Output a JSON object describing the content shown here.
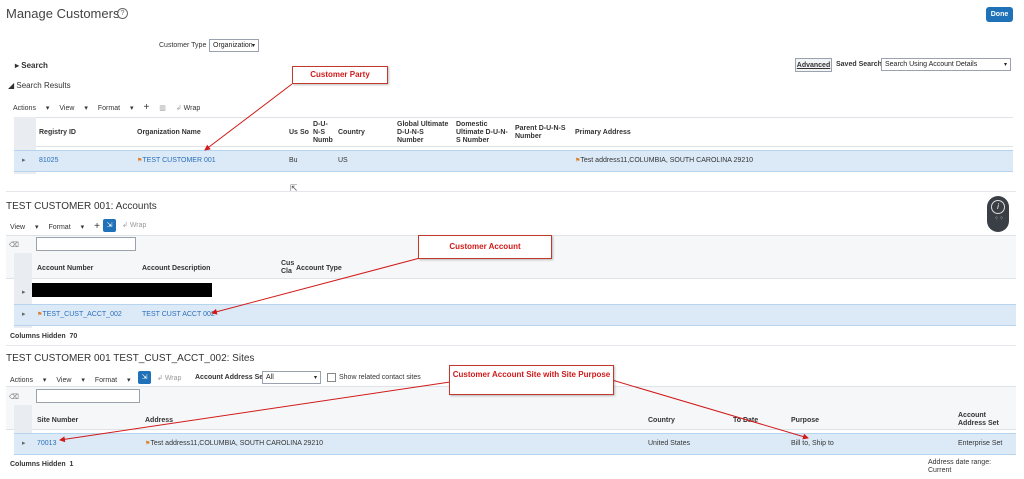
{
  "page": {
    "title": "Manage Customers",
    "done_label": "Done",
    "help_icon": "help-circle-icon"
  },
  "search": {
    "customer_type_label": "Customer Type",
    "customer_type_value": "Organization",
    "search_label": "Search",
    "search_results_label": "Search Results",
    "advanced_label": "Advanced",
    "saved_search_label": "Saved Search",
    "saved_search_value": "Search Using Account Details"
  },
  "results_toolbar": {
    "actions": "Actions",
    "view": "View",
    "format": "Format",
    "wrap": "Wrap"
  },
  "results_table": {
    "headers": {
      "registry_id": "Registry ID",
      "org_name": "Organization Name",
      "us": "Us",
      "so": "So",
      "duns": "D-U-N-S Numb",
      "country": "Country",
      "global_duns": "Global Ultimate D-U-N-S Number",
      "domestic_duns": "Domestic Ultimate D-U-N-S Number",
      "parent_duns": "Parent D-U-N-S Number",
      "primary_address": "Primary Address"
    },
    "row": {
      "registry_id": "81025",
      "org_name": "TEST CUSTOMER 001",
      "us": "Bu",
      "country": "US",
      "primary_address": "Test address11,COLUMBIA, SOUTH CAROLINA 29210"
    }
  },
  "accounts": {
    "title": "TEST CUSTOMER 001: Accounts",
    "toolbar": {
      "view": "View",
      "format": "Format",
      "wrap": "Wrap"
    },
    "headers": {
      "account_number": "Account Number",
      "account_description": "Account Description",
      "cust_class": "Cus Cla",
      "account_type": "Account Type"
    },
    "rows": [
      {
        "account_number": "TEST_CUST_ACCT_002",
        "account_description": "TEST CUST ACCT 002"
      }
    ],
    "columns_hidden_label": "Columns Hidden",
    "columns_hidden_count": "70"
  },
  "sites": {
    "title": "TEST CUSTOMER 001 TEST_CUST_ACCT_002: Sites",
    "toolbar": {
      "actions": "Actions",
      "view": "View",
      "format": "Format",
      "wrap": "Wrap",
      "address_set_label": "Account Address Set",
      "address_set_value": "All",
      "show_related_label": "Show related contact sites"
    },
    "headers": {
      "site_number": "Site Number",
      "address": "Address",
      "country": "Country",
      "to_date": "To Date",
      "purpose": "Purpose",
      "account_address_set": "Account Address Set"
    },
    "row": {
      "site_number": "70013",
      "address": "Test address11,COLUMBIA, SOUTH CAROLINA 29210",
      "country": "United States",
      "purpose": "Bill to, Ship to",
      "account_address_set": "Enterprise Set"
    },
    "columns_hidden_label": "Columns Hidden",
    "columns_hidden_count": "1",
    "address_date_range_label": "Address date range:",
    "address_date_range_value": "Current"
  },
  "annotations": {
    "customer_party": "Customer Party",
    "customer_account": "Customer Account",
    "customer_site": "Customer Account Site with Site Purpose"
  },
  "colors": {
    "accent": "#1f72b8",
    "selected_row": "#dceaf7",
    "annotation_red": "#d11a1a"
  }
}
